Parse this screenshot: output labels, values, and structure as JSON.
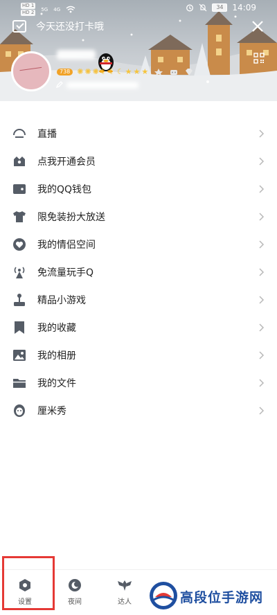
{
  "status_bar": {
    "sim1": "HD 1",
    "sim2": "HD 2",
    "net1": "5G",
    "net2": "4G",
    "battery": "34",
    "time": "14:09"
  },
  "header": {
    "checkin_text": "今天还没打卡哦",
    "vip_badge": "738",
    "level_icons": [
      "sun",
      "sun",
      "sun",
      "moon",
      "moon",
      "moon",
      "star",
      "star",
      "star"
    ]
  },
  "menu": [
    {
      "label": "直播",
      "icon": "live-icon"
    },
    {
      "label": "点我开通会员",
      "icon": "membership-crown-icon"
    },
    {
      "label": "我的QQ钱包",
      "icon": "wallet-icon"
    },
    {
      "label": "限免装扮大放送",
      "icon": "shirt-icon"
    },
    {
      "label": "我的情侣空间",
      "icon": "heart-icon"
    },
    {
      "label": "免流量玩手Q",
      "icon": "signal-tower-icon"
    },
    {
      "label": "精品小游戏",
      "icon": "joystick-icon"
    },
    {
      "label": "我的收藏",
      "icon": "bookmark-icon"
    },
    {
      "label": "我的相册",
      "icon": "photo-icon"
    },
    {
      "label": "我的文件",
      "icon": "folder-icon"
    },
    {
      "label": "厘米秀",
      "icon": "cmshow-face-icon"
    }
  ],
  "bottom_bar": {
    "settings": "设置",
    "night": "夜间",
    "expert": "达人"
  },
  "watermark": "高段位手游网",
  "colors": {
    "icon": "#555c66",
    "chevron": "#b8b8b8",
    "highlight": "#e53935",
    "watermark": "#1f4fa0"
  }
}
